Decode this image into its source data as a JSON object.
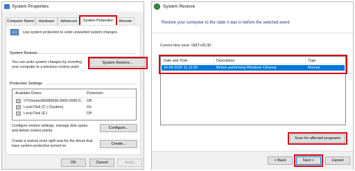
{
  "left_window": {
    "title": "System Properties",
    "tabs": [
      "Computer Name",
      "Hardware",
      "Advanced",
      "System Protection",
      "Remote"
    ],
    "intro_text": "Use system protection to undo unwanted system changes.",
    "system_restore": {
      "section_title": "System Restore",
      "description": "You can undo system changes by reverting your computer to a previous restore point.",
      "button_label": "System Restore..."
    },
    "protection_settings": {
      "section_title": "Protection Settings",
      "columns": [
        "Available Drives",
        "Protection"
      ],
      "drives": [
        {
          "name": "\\\\?\\Volume{8b585030-0000-0000-0...",
          "protection": "Off"
        },
        {
          "name": "Local Disk (C:) (System)",
          "protection": "On"
        },
        {
          "name": "Local Disk (E:)",
          "protection": "Off"
        }
      ],
      "configure_text": "Configure restore settings, manage disk space, and delete restore points.",
      "configure_button": "Configure...",
      "create_text": "Create a restore point right now for the drives that have system protection turned on.",
      "create_button": "Create..."
    },
    "footer": {
      "ok": "OK",
      "cancel": "Cancel",
      "apply": "Apply"
    }
  },
  "right_window": {
    "title": "System Restore",
    "header_text": "Restore your computer to the state it was in before the selected event",
    "time_zone": "Current time zone: GMT+05:30",
    "columns": [
      "Date and Time",
      "Description",
      "Type"
    ],
    "rows": [
      {
        "date": "16-05-2020 11:12:00",
        "description": "Before performing Windows Cleanup",
        "type": "Manual"
      }
    ],
    "scan_button": "Scan for affected programs",
    "footer": {
      "back": "< Back",
      "next": "Next >",
      "cancel": "Cancel"
    }
  },
  "colors": {
    "highlight": "#d0000f",
    "selection": "#0078d7"
  },
  "icons": [
    "shield-computer-icon",
    "system-restore-icon",
    "drive-icon"
  ]
}
